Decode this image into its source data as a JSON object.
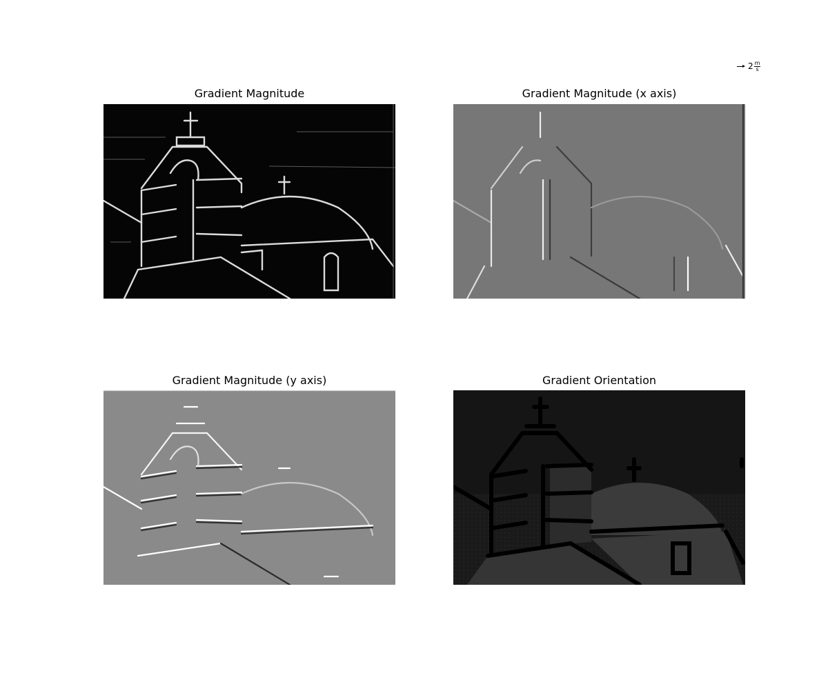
{
  "panels": [
    {
      "title": "Gradient Magnitude"
    },
    {
      "title": "Gradient Magnitude (x axis)"
    },
    {
      "title": "Gradient Magnitude (y axis)"
    },
    {
      "title": "Gradient Orientation"
    }
  ],
  "quiver_key": {
    "coefficient": "2",
    "unit_num": "m",
    "unit_den": "s"
  },
  "colors": {
    "magnitude_bg": "#050505",
    "x_axis_bg": "#777777",
    "y_axis_bg": "#8a8a8a",
    "orientation_bg": "#151515"
  }
}
